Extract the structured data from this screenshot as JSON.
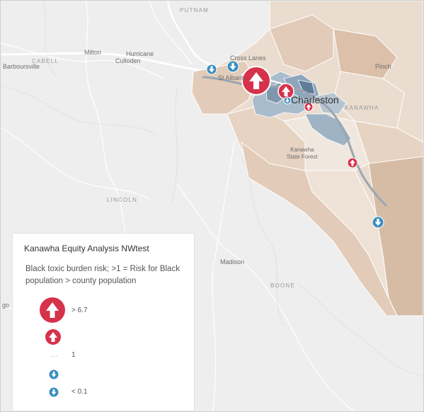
{
  "map": {
    "places": {
      "putnam": "PUTNAM",
      "cabell": "CABELL",
      "milton": "Milton",
      "hurricane": "Hurricane",
      "culloden": "Culloden",
      "barboursville": "Barboursville",
      "cross_lanes": "Cross Lanes",
      "st_albans": "St Albans",
      "charleston": "Charleston",
      "kanawha": "KANAWHA",
      "pinch": "Pinch",
      "kanawha_state_forest": "Kanawha\nState Forest",
      "lincoln": "LINCOLN",
      "madison": "Madison",
      "boone": "BOONE",
      "go": "go"
    },
    "colors": {
      "risk_high": "#d7324b",
      "risk_low": "#3b8ec2",
      "tract_tan": "#e2cbb8",
      "tract_blue": "#8eaac0"
    }
  },
  "legend": {
    "title": "Kanawha Equity Analysis NWtest",
    "description": "Black toxic burden risk; >1 = Risk for Black population > county population",
    "items": [
      {
        "label": "> 6.7",
        "symbol": "arrow-up-large"
      },
      {
        "label": "",
        "symbol": "arrow-up-medium"
      },
      {
        "label": "1",
        "symbol": "dots"
      },
      {
        "label": "",
        "symbol": "arrow-down-small"
      },
      {
        "label": "< 0.1",
        "symbol": "arrow-down-small"
      }
    ]
  }
}
